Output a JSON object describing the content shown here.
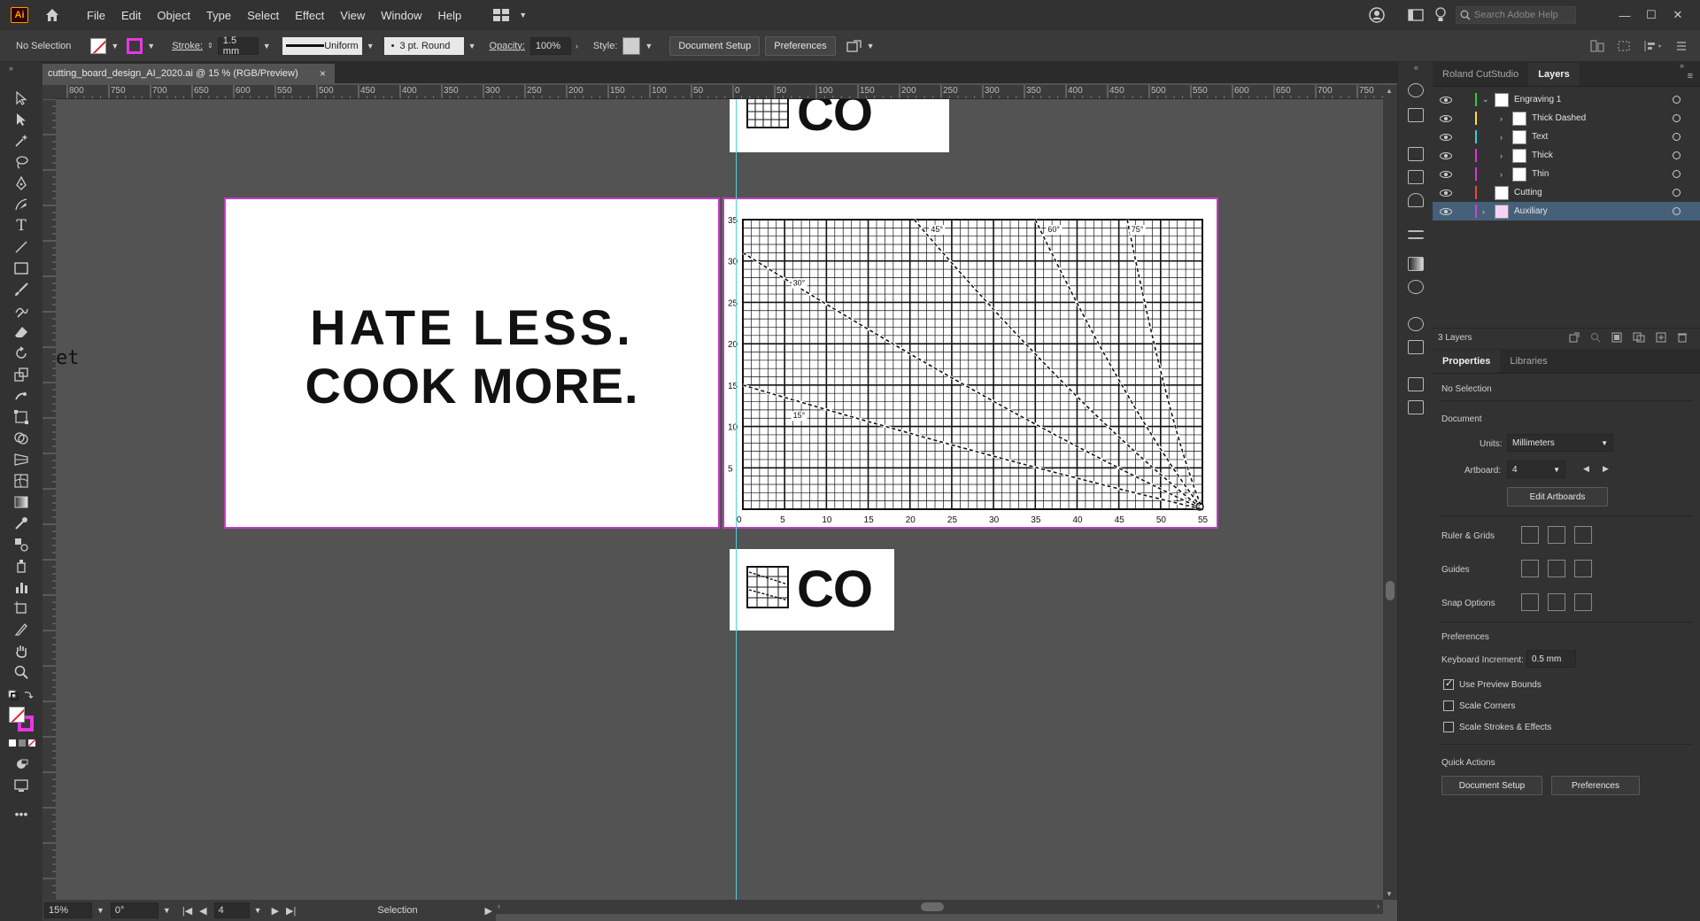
{
  "app": {
    "logo": "Ai",
    "menus": [
      "File",
      "Edit",
      "Object",
      "Type",
      "Select",
      "Effect",
      "View",
      "Window",
      "Help"
    ],
    "search_placeholder": "Search Adobe Help"
  },
  "control": {
    "selection_label": "No Selection",
    "stroke_label": "Stroke:",
    "stroke_value": "1.5 mm",
    "stroke_profile": "Uniform",
    "brush": "3 pt. Round",
    "opacity_label": "Opacity:",
    "opacity_value": "100%",
    "style_label": "Style:",
    "doc_setup": "Document Setup",
    "preferences": "Preferences",
    "fill_color": "#ffffff",
    "stroke_color": "#e836e6"
  },
  "document": {
    "tab_title": "cutting_board_design_AI_2020.ai @ 15 % (RGB/Preview)",
    "close": "×"
  },
  "ruler": {
    "h_labels": [
      "800",
      "750",
      "700",
      "650",
      "600",
      "550",
      "500",
      "450",
      "400",
      "350",
      "300",
      "250",
      "200",
      "150",
      "100",
      "50",
      "0",
      "50",
      "100",
      "150",
      "200",
      "250",
      "300",
      "350",
      "400",
      "450",
      "500",
      "550",
      "600",
      "650",
      "700",
      "750"
    ]
  },
  "canvas": {
    "slogan_line1": "HATE LESS.",
    "slogan_line2": "COOK MORE.",
    "co_text": "CO",
    "side_text": "et",
    "grid": {
      "x_ticks": [
        "0",
        "5",
        "10",
        "15",
        "20",
        "25",
        "30",
        "35",
        "40",
        "45",
        "50",
        "55"
      ],
      "y_ticks": [
        "35",
        "30",
        "25",
        "20",
        "15",
        "10",
        "5"
      ],
      "angle_labels": [
        "45°",
        "60°",
        "75°",
        "30°",
        "15°"
      ]
    }
  },
  "status": {
    "zoom": "15%",
    "rotate": "0°",
    "artboard": "4",
    "tool": "Selection"
  },
  "panels": {
    "tabs": [
      "Roland CutStudio",
      "Layers"
    ],
    "layers": [
      {
        "name": "Engraving 1",
        "color": "#33cc33",
        "expanded": true
      },
      {
        "name": "Thick Dashed",
        "color": "#ffdd33",
        "sub": true
      },
      {
        "name": "Text",
        "color": "#33ccdd",
        "sub": true
      },
      {
        "name": "Thick",
        "color": "#dd33dd",
        "sub": true
      },
      {
        "name": "Thin",
        "color": "#dd33dd",
        "sub": true
      },
      {
        "name": "Cutting",
        "color": "#ee4444"
      },
      {
        "name": "Auxiliary",
        "color": "#cc44cc",
        "selected": true
      }
    ],
    "layer_count": "3 Layers",
    "prop_tabs": [
      "Properties",
      "Libraries"
    ],
    "no_selection": "No Selection",
    "document_title": "Document",
    "units_label": "Units:",
    "units_value": "Millimeters",
    "artboard_label": "Artboard:",
    "artboard_value": "4",
    "edit_artboards": "Edit Artboards",
    "ruler_grids": "Ruler & Grids",
    "guides": "Guides",
    "snap_options": "Snap Options",
    "preferences_title": "Preferences",
    "keyboard_increment_label": "Keyboard Increment:",
    "keyboard_increment_value": "0.5 mm",
    "use_preview_bounds": "Use Preview Bounds",
    "scale_corners": "Scale Corners",
    "scale_strokes": "Scale Strokes & Effects",
    "quick_actions": "Quick Actions",
    "doc_setup_btn": "Document Setup",
    "preferences_btn": "Preferences"
  }
}
